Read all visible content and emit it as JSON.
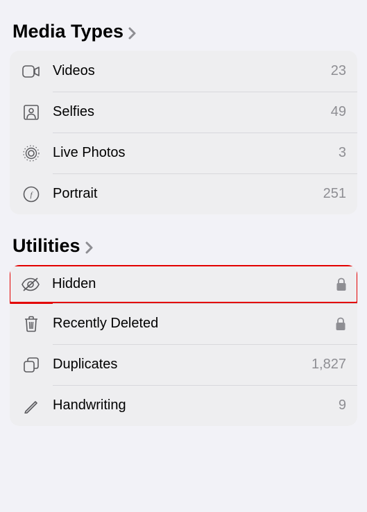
{
  "sections": {
    "mediaTypes": {
      "title": "Media Types",
      "items": [
        {
          "label": "Videos",
          "count": "23"
        },
        {
          "label": "Selfies",
          "count": "49"
        },
        {
          "label": "Live Photos",
          "count": "3"
        },
        {
          "label": "Portrait",
          "count": "251"
        }
      ]
    },
    "utilities": {
      "title": "Utilities",
      "items": [
        {
          "label": "Hidden",
          "locked": true
        },
        {
          "label": "Recently Deleted",
          "locked": true
        },
        {
          "label": "Duplicates",
          "count": "1,827"
        },
        {
          "label": "Handwriting",
          "count": "9"
        }
      ]
    }
  }
}
